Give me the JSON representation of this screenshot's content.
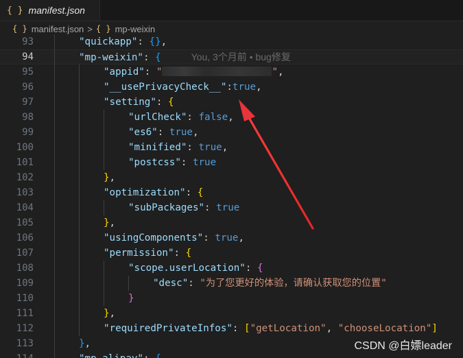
{
  "tab": {
    "icon": "{ }",
    "label": "manifest.json"
  },
  "breadcrumb": {
    "file_icon": "{ }",
    "file": "manifest.json",
    "sep": ">",
    "node_icon": "{ }",
    "node": "mp-weixin"
  },
  "blame": "You, 3个月前 • bug修复",
  "watermark": "CSDN @白嫖leader",
  "lines": [
    {
      "num": "93",
      "indent": 1,
      "tokens": [
        [
          "k",
          "\"quickapp\""
        ],
        [
          "p",
          ": "
        ],
        [
          "b3",
          "{"
        ],
        [
          "b3",
          "}"
        ],
        [
          "p",
          ","
        ]
      ]
    },
    {
      "num": "94",
      "indent": 1,
      "current": true,
      "tokens": [
        [
          "k",
          "\"mp-weixin\""
        ],
        [
          "p",
          ": "
        ],
        [
          "b3",
          "{"
        ]
      ]
    },
    {
      "num": "95",
      "indent": 2,
      "tokens": [
        [
          "k",
          "\"appid\""
        ],
        [
          "p",
          ": "
        ],
        [
          "s",
          "\""
        ],
        [
          "redact",
          ""
        ],
        [
          "s",
          "\""
        ],
        [
          "p",
          ","
        ]
      ]
    },
    {
      "num": "96",
      "indent": 2,
      "tokens": [
        [
          "k",
          "\"__usePrivacyCheck__\""
        ],
        [
          "p",
          ":"
        ],
        [
          "kw",
          "true"
        ],
        [
          "p",
          ","
        ]
      ]
    },
    {
      "num": "97",
      "indent": 2,
      "tokens": [
        [
          "k",
          "\"setting\""
        ],
        [
          "p",
          ": "
        ],
        [
          "b1",
          "{"
        ]
      ]
    },
    {
      "num": "98",
      "indent": 3,
      "tokens": [
        [
          "k",
          "\"urlCheck\""
        ],
        [
          "p",
          ": "
        ],
        [
          "kw",
          "false"
        ],
        [
          "p",
          ","
        ]
      ]
    },
    {
      "num": "99",
      "indent": 3,
      "tokens": [
        [
          "k",
          "\"es6\""
        ],
        [
          "p",
          ": "
        ],
        [
          "kw",
          "true"
        ],
        [
          "p",
          ","
        ]
      ]
    },
    {
      "num": "100",
      "indent": 3,
      "tokens": [
        [
          "k",
          "\"minified\""
        ],
        [
          "p",
          ": "
        ],
        [
          "kw",
          "true"
        ],
        [
          "p",
          ","
        ]
      ]
    },
    {
      "num": "101",
      "indent": 3,
      "tokens": [
        [
          "k",
          "\"postcss\""
        ],
        [
          "p",
          ": "
        ],
        [
          "kw",
          "true"
        ]
      ]
    },
    {
      "num": "102",
      "indent": 2,
      "tokens": [
        [
          "b1",
          "}"
        ],
        [
          "p",
          ","
        ]
      ]
    },
    {
      "num": "103",
      "indent": 2,
      "tokens": [
        [
          "k",
          "\"optimization\""
        ],
        [
          "p",
          ": "
        ],
        [
          "b1",
          "{"
        ]
      ]
    },
    {
      "num": "104",
      "indent": 3,
      "tokens": [
        [
          "k",
          "\"subPackages\""
        ],
        [
          "p",
          ": "
        ],
        [
          "kw",
          "true"
        ]
      ]
    },
    {
      "num": "105",
      "indent": 2,
      "tokens": [
        [
          "b1",
          "}"
        ],
        [
          "p",
          ","
        ]
      ]
    },
    {
      "num": "106",
      "indent": 2,
      "tokens": [
        [
          "k",
          "\"usingComponents\""
        ],
        [
          "p",
          ": "
        ],
        [
          "kw",
          "true"
        ],
        [
          "p",
          ","
        ]
      ]
    },
    {
      "num": "107",
      "indent": 2,
      "tokens": [
        [
          "k",
          "\"permission\""
        ],
        [
          "p",
          ": "
        ],
        [
          "b1",
          "{"
        ]
      ]
    },
    {
      "num": "108",
      "indent": 3,
      "tokens": [
        [
          "k",
          "\"scope.userLocation\""
        ],
        [
          "p",
          ": "
        ],
        [
          "b2",
          "{"
        ]
      ]
    },
    {
      "num": "109",
      "indent": 4,
      "tokens": [
        [
          "k",
          "\"desc\""
        ],
        [
          "p",
          ": "
        ],
        [
          "s",
          "\"为了您更好的体验，请确认获取您的位置\""
        ]
      ]
    },
    {
      "num": "110",
      "indent": 3,
      "tokens": [
        [
          "b2",
          "}"
        ]
      ]
    },
    {
      "num": "111",
      "indent": 2,
      "tokens": [
        [
          "b1",
          "}"
        ],
        [
          "p",
          ","
        ]
      ]
    },
    {
      "num": "112",
      "indent": 2,
      "tokens": [
        [
          "k",
          "\"requiredPrivateInfos\""
        ],
        [
          "p",
          ": "
        ],
        [
          "b1",
          "["
        ],
        [
          "s",
          "\"getLocation\""
        ],
        [
          "p",
          ", "
        ],
        [
          "s",
          "\"chooseLocation\""
        ],
        [
          "b1",
          "]"
        ]
      ]
    },
    {
      "num": "113",
      "indent": 1,
      "tokens": [
        [
          "b3",
          "}"
        ],
        [
          "p",
          ","
        ]
      ]
    },
    {
      "num": "114",
      "indent": 1,
      "tokens": [
        [
          "k",
          "\"mp-alipay\""
        ],
        [
          "p",
          ": "
        ],
        [
          "b3",
          "{"
        ]
      ]
    }
  ],
  "colors": {
    "background": "#1f1f1f",
    "key": "#9cdcfe",
    "string": "#ce9178",
    "keyword": "#569cd6",
    "arrow": "#e8343b"
  }
}
